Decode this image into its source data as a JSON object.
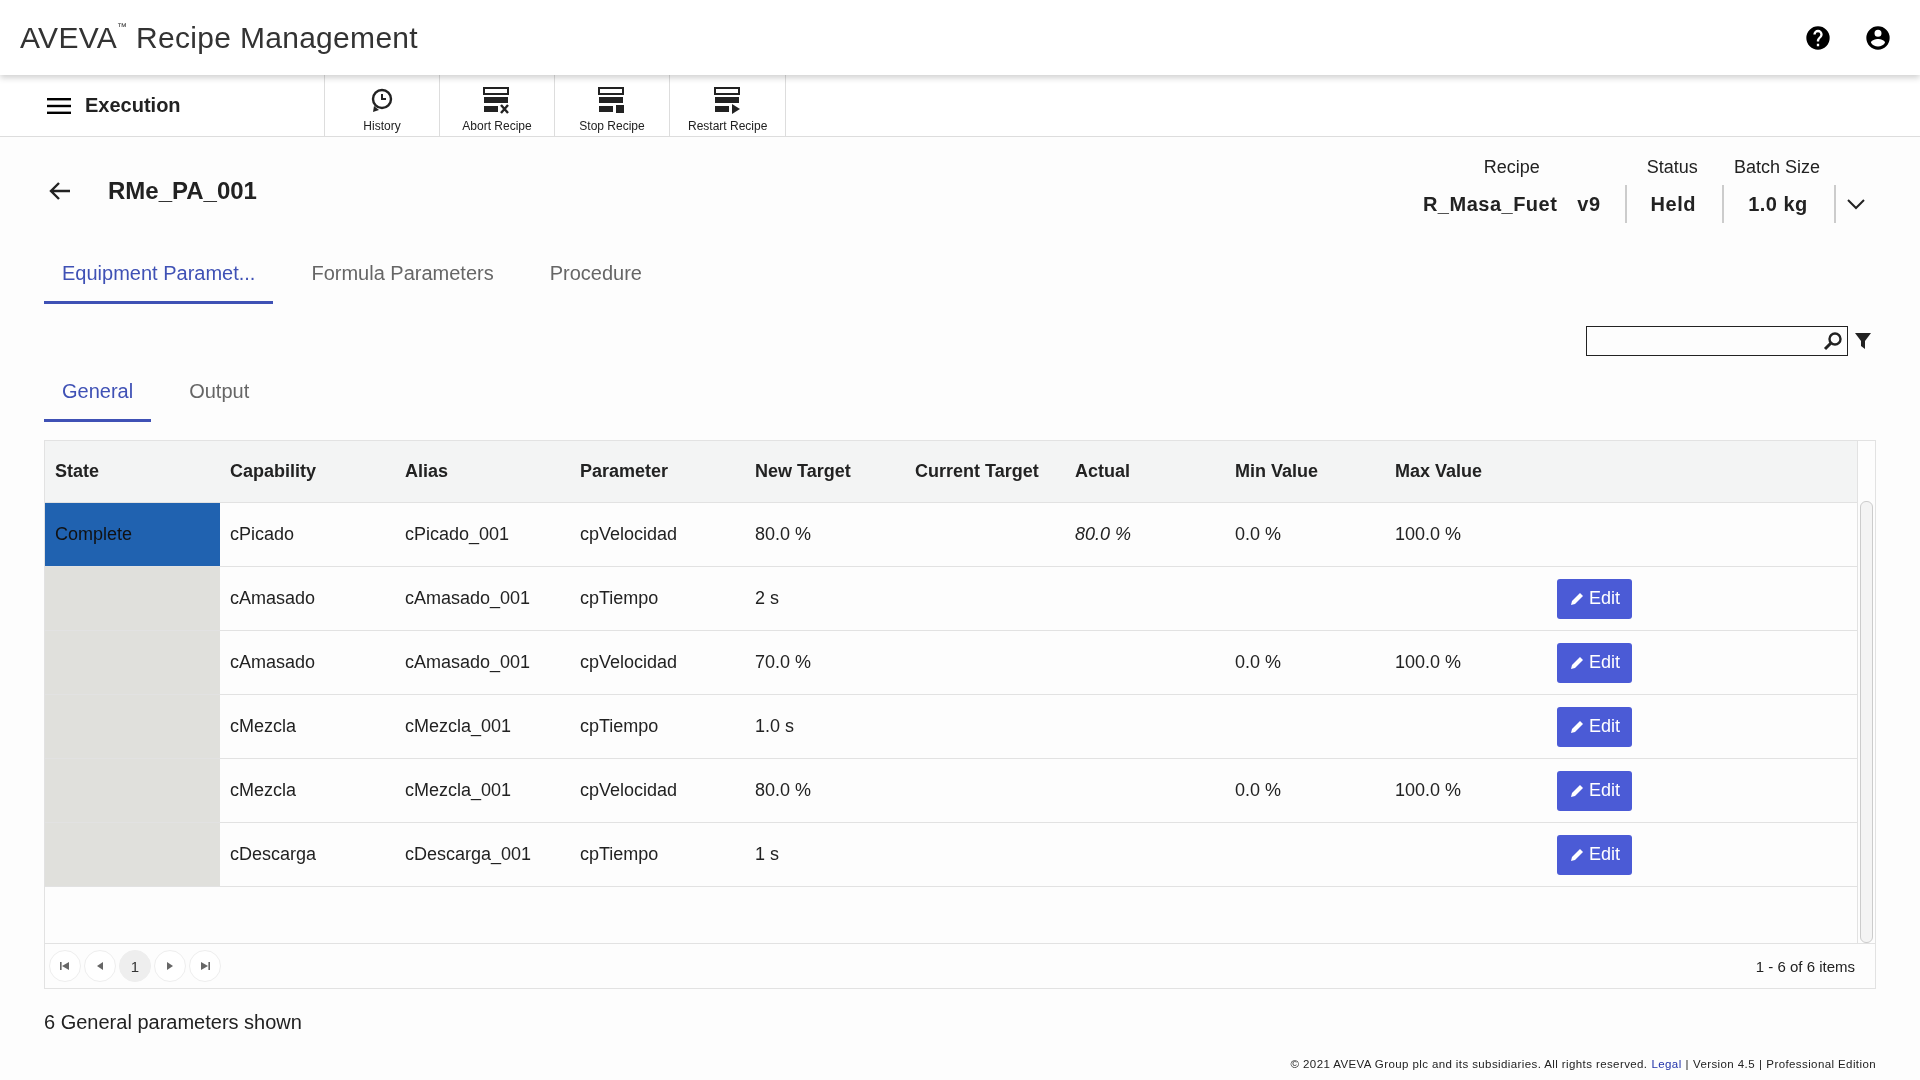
{
  "app": {
    "brand": "AVEVA",
    "trademark": "™",
    "title": "Recipe Management"
  },
  "nav": {
    "title": "Execution"
  },
  "toolbar": [
    {
      "kind": "history",
      "label": "History"
    },
    {
      "kind": "abort",
      "label": "Abort Recipe"
    },
    {
      "kind": "stop",
      "label": "Stop Recipe"
    },
    {
      "kind": "restart",
      "label": "Restart Recipe"
    }
  ],
  "page_title": "RMe_PA_001",
  "info": {
    "recipe_label": "Recipe",
    "recipe": "R_Masa_Fuet",
    "version": "v9",
    "status_label": "Status",
    "status": "Held",
    "batch_label": "Batch Size",
    "batch": "1.0 kg"
  },
  "tabs": [
    {
      "label": "Equipment Paramet...",
      "selected": true
    },
    {
      "label": "Formula Parameters",
      "selected": false
    },
    {
      "label": "Procedure",
      "selected": false
    }
  ],
  "subtabs": [
    {
      "label": "General",
      "selected": true
    },
    {
      "label": "Output",
      "selected": false
    }
  ],
  "table": {
    "columns": [
      "State",
      "Capability",
      "Alias",
      "Parameter",
      "New Target",
      "Current Target",
      "Actual",
      "Min Value",
      "Max Value"
    ],
    "rows": [
      {
        "state": "Complete",
        "capability": "cPicado",
        "alias": "cPicado_001",
        "parameter": "cpVelocidad",
        "new_target": "80.0 %",
        "actual": "80.0 %",
        "min": "0.0 %",
        "max": "100.0 %"
      },
      {
        "capability": "cAmasado",
        "alias": "cAmasado_001",
        "parameter": "cpTiempo",
        "new_target": "2 s",
        "action": "Edit"
      },
      {
        "capability": "cAmasado",
        "alias": "cAmasado_001",
        "parameter": "cpVelocidad",
        "new_target": "70.0 %",
        "min": "0.0 %",
        "max": "100.0 %",
        "action": "Edit"
      },
      {
        "capability": "cMezcla",
        "alias": "cMezcla_001",
        "parameter": "cpTiempo",
        "new_target": "1.0 s",
        "action": "Edit"
      },
      {
        "capability": "cMezcla",
        "alias": "cMezcla_001",
        "parameter": "cpVelocidad",
        "new_target": "80.0 %",
        "min": "0.0 %",
        "max": "100.0 %",
        "action": "Edit"
      },
      {
        "capability": "cDescarga",
        "alias": "cDescarga_001",
        "parameter": "cpTiempo",
        "new_target": "1 s",
        "action": "Edit"
      }
    ]
  },
  "pager": {
    "pages": [
      {
        "label": "1",
        "selected": true
      }
    ],
    "summary": "1 - 6 of 6 items"
  },
  "shown_text": "6 General parameters shown",
  "footer": {
    "copyright": "© 2021 AVEVA Group plc and its subsidiaries. All rights reserved.",
    "legal": "Legal",
    "sep1": "|",
    "version": "Version 4.5",
    "sep2": "|",
    "edition": "Professional Edition"
  }
}
